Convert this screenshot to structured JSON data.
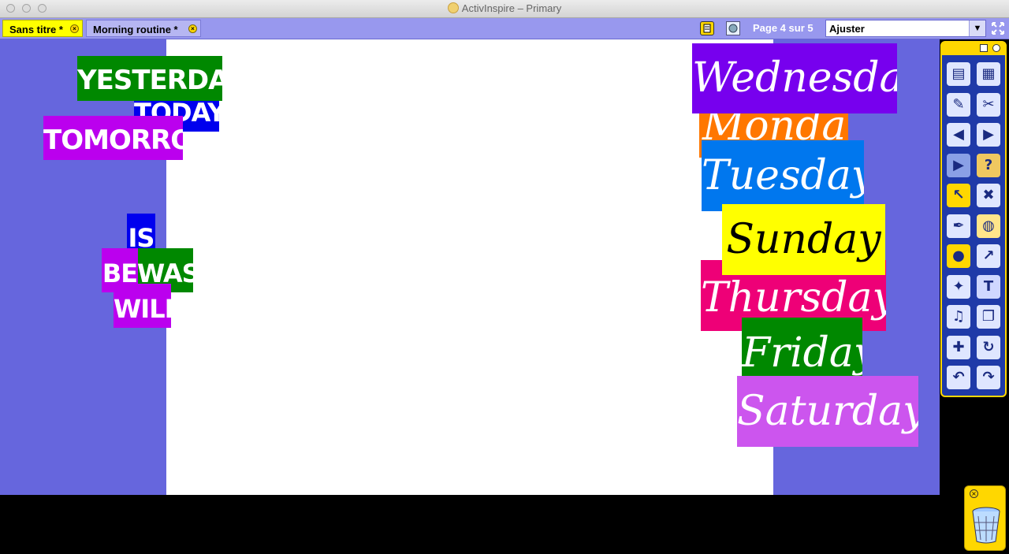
{
  "window": {
    "title": "ActivInspire – Primary"
  },
  "tabs": [
    {
      "label": "Sans titre *",
      "active": true
    },
    {
      "label": "Morning routine *",
      "active": false
    }
  ],
  "toolbar": {
    "page_info": "Page 4 sur 5",
    "zoom_value": "Ajuster"
  },
  "word_cards": {
    "yesterday": {
      "text": "YESTERDAY",
      "color": "#008800"
    },
    "today": {
      "text": "TODAY",
      "color": "#0000ee"
    },
    "tomorrow": {
      "text": "TOMORROW",
      "color": "#bb00ee"
    },
    "is": {
      "text": "IS",
      "color": "#0000ee"
    },
    "was": {
      "text": "WAS",
      "color": "#008800"
    },
    "be": {
      "text": "BE",
      "color": "#bb00ee"
    },
    "will": {
      "text": "WILL",
      "color": "#bb00ee"
    }
  },
  "day_cards": {
    "monday": {
      "text": "Monday",
      "color": "#ff7700"
    },
    "wednesday": {
      "text": "Wednesday",
      "color": "#7700ee"
    },
    "tuesday": {
      "text": "Tuesday",
      "color": "#0077ee"
    },
    "thursday": {
      "text": "Thursday",
      "color": "#ee0077"
    },
    "sunday": {
      "text": "Sunday",
      "color": "#ffff00"
    },
    "friday": {
      "text": "Friday",
      "color": "#008800"
    },
    "saturday": {
      "text": "Saturday",
      "color": "#cc55ee"
    }
  },
  "colors": {
    "canvas_background": "#6666dd",
    "page": "#ffffff",
    "tabbar": "#9898ee",
    "toolbox": "#1f3aa8",
    "toolbox_border": "#ffd700"
  },
  "toolbox_icons": [
    "page-browser-icon",
    "resource-browser-icon",
    "annotate-desktop-icon",
    "tools-icon",
    "previous-page-icon",
    "next-page-icon",
    "play-icon",
    "help-icon",
    "select-icon",
    "edit-icon",
    "pen-icon",
    "fill-icon",
    "shape-icon",
    "connector-icon",
    "magic-ink-icon",
    "text-icon",
    "media-icon",
    "duplicate-icon",
    "eraser-icon",
    "reset-page-icon",
    "undo-icon",
    "redo-icon"
  ]
}
